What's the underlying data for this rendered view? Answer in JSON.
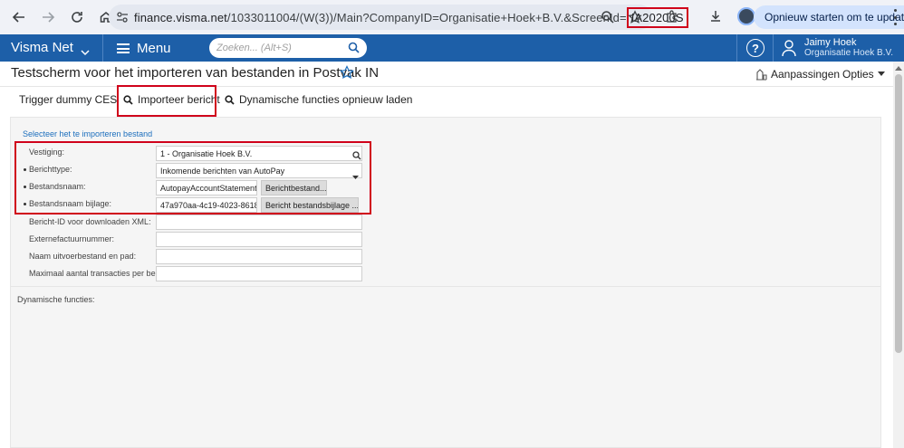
{
  "browser": {
    "url_host": "finance.visma.net",
    "url_path": "/1033011004/(W(3))/Main?CompanyID=Organisatie+Hoek+B.V.&ScreenId=",
    "url_screen_id": "IA20200S",
    "restart_label": "Opnieuw starten om te updaten",
    "icons": [
      "back-icon",
      "forward-icon",
      "reload-icon",
      "home-icon",
      "site-info-icon",
      "zoom-icon",
      "bookmark-star-icon",
      "extensions-icon",
      "download-icon",
      "profile-avatar",
      "kebab-menu-icon"
    ]
  },
  "app": {
    "brand": "Visma Net",
    "menu_label": "Menu",
    "search_placeholder": "Zoeken... (Alt+S)",
    "user_name": "Jaimy Hoek",
    "user_company": "Organisatie Hoek B.V.",
    "accent": "#1d5fa8"
  },
  "page": {
    "title": "Testscherm voor het importeren van bestanden in Postvak IN",
    "aanpassingen": "Aanpassingen",
    "opties": "Opties"
  },
  "toolbar": {
    "trigger": "Trigger dummy CES",
    "importeer": "Importeer bericht",
    "dynamisch": "Dynamische functies opnieuw laden"
  },
  "form": {
    "section_title": "Selecteer het te importeren bestand",
    "vestiging_label": "Vestiging:",
    "vestiging_value": "1 - Organisatie Hoek B.V.",
    "berichttype_label": "Berichttype:",
    "berichttype_value": "Inkomende berichten van AutoPay",
    "bestandsnaam_label": "Bestandsnaam:",
    "bestandsnaam_value": "AutopayAccountStatementM",
    "bestandsnaam_btn": "Berichtbestand...",
    "bijlage_label": "Bestandsnaam bijlage:",
    "bijlage_value": "47a970aa-4c19-4023-8618",
    "bijlage_btn": "Bericht bestandsbijlage ...",
    "bericht_id_label": "Bericht-ID voor downloaden XML:",
    "bericht_id_value": "",
    "extern_label": "Externefactuurnummer:",
    "extern_value": "",
    "uitvoer_label": "Naam uitvoerbestand en pad:",
    "uitvoer_value": "",
    "max_label": "Maximaal aantal transacties per be...",
    "max_value": ""
  },
  "dynamic": {
    "label": "Dynamische functies:"
  }
}
